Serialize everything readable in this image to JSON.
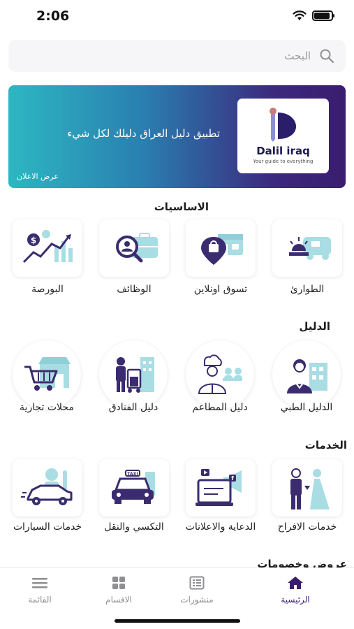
{
  "status_bar": {
    "time": "2:06"
  },
  "search": {
    "placeholder": "البحث"
  },
  "banner": {
    "tagline": "تطبيق دليل العراق دليلك لكل شيء",
    "cta": "عرض الاعلان",
    "logo_name": "Dalil iraq",
    "logo_tagline": "Your guide to everything"
  },
  "sections": {
    "basics": {
      "title": "الاساسيات",
      "items": [
        {
          "label": "الطوارئ",
          "icon": "emergency-icon"
        },
        {
          "label": "تسوق اونلاين",
          "icon": "online-shopping-icon"
        },
        {
          "label": "الوظائف",
          "icon": "jobs-icon"
        },
        {
          "label": "البورصة",
          "icon": "stock-exchange-icon"
        }
      ]
    },
    "guide": {
      "title": "الدليل",
      "items": [
        {
          "label": "الدليل الطبي",
          "icon": "doctor-icon"
        },
        {
          "label": "دليل المطاعم",
          "icon": "chef-icon"
        },
        {
          "label": "دليل الفنادق",
          "icon": "hotel-porter-icon"
        },
        {
          "label": "محلات تجارية",
          "icon": "store-cart-icon"
        }
      ]
    },
    "services": {
      "title": "الخدمات",
      "items": [
        {
          "label": "خدمات الافراح",
          "icon": "wedding-icon"
        },
        {
          "label": "الدعاية والاعلانات",
          "icon": "advertising-icon"
        },
        {
          "label": "التكسي والنقل",
          "icon": "taxi-icon"
        },
        {
          "label": "خدمات السيارات",
          "icon": "car-service-icon"
        }
      ]
    },
    "offers": {
      "title": "عروض وخصومات"
    }
  },
  "bottom_nav": {
    "items": [
      {
        "label": "الرئيسية",
        "icon": "home-icon",
        "active": true
      },
      {
        "label": "منشورات",
        "icon": "posts-icon",
        "active": false
      },
      {
        "label": "الاقسام",
        "icon": "grid-icon",
        "active": false
      },
      {
        "label": "القائمة",
        "icon": "menu-icon",
        "active": false
      }
    ]
  },
  "colors": {
    "primary": "#3a1d6e",
    "teal": "#2db7c2",
    "icon_dark": "#3a2c6e",
    "icon_light": "#a9dde4"
  }
}
